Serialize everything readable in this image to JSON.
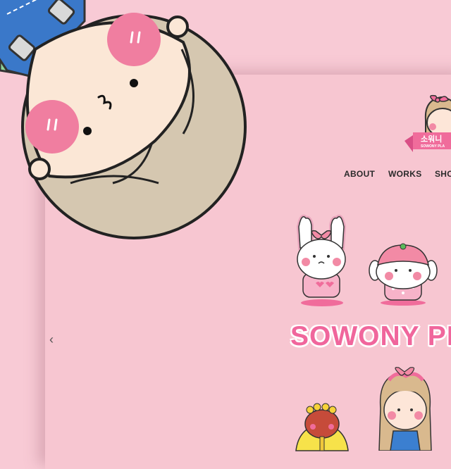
{
  "brand": {
    "logo_text": "소워니",
    "logo_subtext": "SOWONY PLA"
  },
  "nav": {
    "items": [
      {
        "label": "ABOUT"
      },
      {
        "label": "WORKS"
      },
      {
        "label": "SHO"
      }
    ]
  },
  "hero": {
    "title": "SOWONY PL",
    "prev_arrow": "‹"
  },
  "colors": {
    "background": "#f8cad5",
    "accent": "#f0669c",
    "nav_text": "#2b2b2b"
  }
}
